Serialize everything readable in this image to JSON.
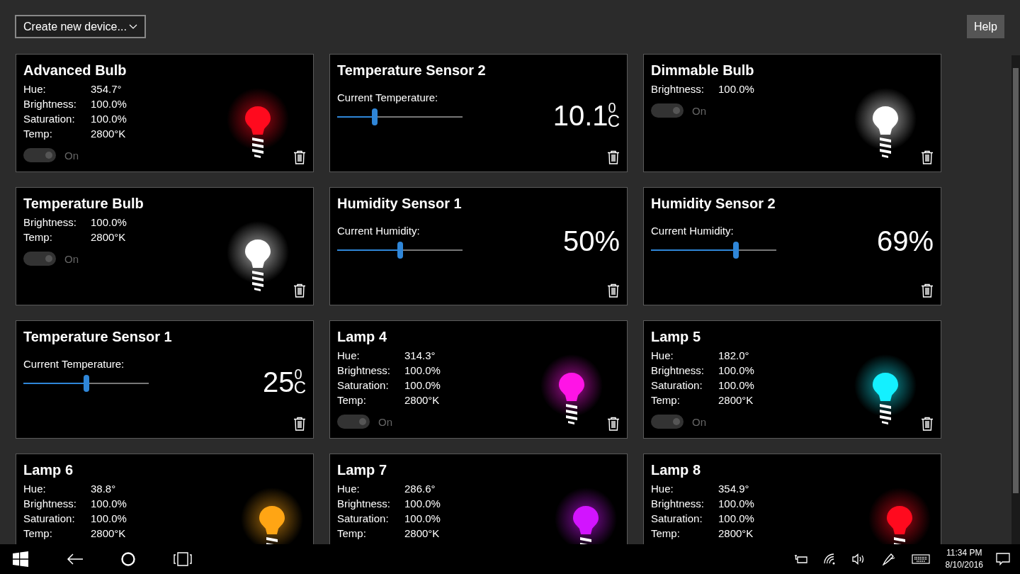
{
  "toolbar": {
    "create_dropdown": "Create new device...",
    "help_button": "Help"
  },
  "devices": [
    {
      "kind": "bulb",
      "title": "Advanced Bulb",
      "color": "#ff0a1e",
      "properties": [
        {
          "label": "Hue:",
          "value": "354.7°"
        },
        {
          "label": "Brightness:",
          "value": "100.0%"
        },
        {
          "label": "Saturation:",
          "value": "100.0%"
        },
        {
          "label": "Temp:",
          "value": "2800°K"
        }
      ],
      "toggle": {
        "label": "On",
        "on": true,
        "disabled": true
      }
    },
    {
      "kind": "sensor",
      "title": "Temperature Sensor 2",
      "label": "Current Temperature:",
      "level": 0.3,
      "reading": "10.1$^{0}$$_{C}$"
    },
    {
      "kind": "bulb",
      "title": "Dimmable Bulb",
      "color": "#ffffff",
      "properties": [
        {
          "label": "Brightness:",
          "value": "100.0%"
        }
      ],
      "toggle": {
        "label": "On",
        "on": true,
        "disabled": true
      }
    },
    {
      "kind": "bulb",
      "title": "Temperature Bulb",
      "color": "#ffffff",
      "properties": [
        {
          "label": "Brightness:",
          "value": "100.0%"
        },
        {
          "label": "Temp:",
          "value": "2800°K"
        }
      ],
      "toggle": {
        "label": "On",
        "on": true,
        "disabled": true
      }
    },
    {
      "kind": "sensor",
      "title": "Humidity Sensor 1",
      "label": "Current Humidity:",
      "level": 0.5,
      "reading": "50%"
    },
    {
      "kind": "sensor",
      "title": "Humidity Sensor 2",
      "label": "Current Humidity:",
      "level": 0.68,
      "reading": "69%"
    },
    {
      "kind": "sensor",
      "title": "Temperature Sensor 1",
      "label": "Current Temperature:",
      "level": 0.5,
      "reading": "25$^{0}$$_{C}$"
    },
    {
      "kind": "bulb",
      "title": "Lamp 4",
      "color": "#ff14e6",
      "properties": [
        {
          "label": "Hue:",
          "value": "314.3°"
        },
        {
          "label": "Brightness:",
          "value": "100.0%"
        },
        {
          "label": "Saturation:",
          "value": "100.0%"
        },
        {
          "label": "Temp:",
          "value": "2800°K"
        }
      ],
      "toggle": {
        "label": "On",
        "on": true,
        "disabled": true
      }
    },
    {
      "kind": "bulb",
      "title": "Lamp 5",
      "color": "#14f0ff",
      "properties": [
        {
          "label": "Hue:",
          "value": "182.0°"
        },
        {
          "label": "Brightness:",
          "value": "100.0%"
        },
        {
          "label": "Saturation:",
          "value": "100.0%"
        },
        {
          "label": "Temp:",
          "value": "2800°K"
        }
      ],
      "toggle": {
        "label": "On",
        "on": true,
        "disabled": true
      }
    },
    {
      "kind": "bulb",
      "title": "Lamp 6",
      "color": "#ffa514",
      "properties": [
        {
          "label": "Hue:",
          "value": "38.8°"
        },
        {
          "label": "Brightness:",
          "value": "100.0%"
        },
        {
          "label": "Saturation:",
          "value": "100.0%"
        },
        {
          "label": "Temp:",
          "value": "2800°K"
        }
      ]
    },
    {
      "kind": "bulb",
      "title": "Lamp 7",
      "color": "#d214ff",
      "properties": [
        {
          "label": "Hue:",
          "value": "286.6°"
        },
        {
          "label": "Brightness:",
          "value": "100.0%"
        },
        {
          "label": "Saturation:",
          "value": "100.0%"
        },
        {
          "label": "Temp:",
          "value": "2800°K"
        }
      ]
    },
    {
      "kind": "bulb",
      "title": "Lamp 8",
      "color": "#ff0a1e",
      "properties": [
        {
          "label": "Hue:",
          "value": "354.9°"
        },
        {
          "label": "Brightness:",
          "value": "100.0%"
        },
        {
          "label": "Saturation:",
          "value": "100.0%"
        },
        {
          "label": "Temp:",
          "value": "2800°K"
        }
      ]
    }
  ],
  "taskbar": {
    "time": "11:34 PM",
    "date": "8/10/2016"
  }
}
